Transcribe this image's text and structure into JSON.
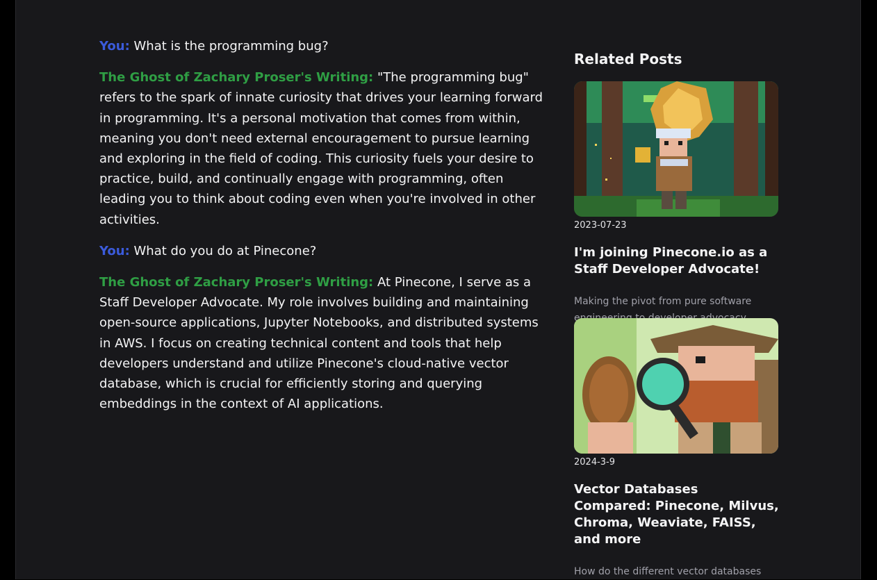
{
  "chat": {
    "messages": [
      {
        "speaker": "You:",
        "text": "What is the programming bug?"
      },
      {
        "speaker": "The Ghost of Zachary Proser's Writing:",
        "text": "\"The programming bug\" refers to the spark of innate curiosity that drives your learning forward in programming. It's a personal motivation that comes from within, meaning you don't need external encouragement to pursue learning and exploring in the field of coding. This curiosity fuels your desire to practice, build, and continually engage with programming, often leading you to think about coding even when you're involved in other activities."
      },
      {
        "speaker": "You:",
        "text": "What do you do at Pinecone?"
      },
      {
        "speaker": "The Ghost of Zachary Proser's Writing:",
        "text": "At Pinecone, I serve as a Staff Developer Advocate. My role involves building and maintaining open-source applications, Jupyter Notebooks, and distributed systems in AWS. I focus on creating technical content and tools that help developers understand and utilize Pinecone's cloud-native vector database, which is crucial for efficiently storing and querying embeddings in the context of AI applications."
      }
    ]
  },
  "sidebar": {
    "title": "Related Posts",
    "posts": [
      {
        "image_icon": "pixel-art-explorer-forest-image",
        "date": "2023-07-23",
        "title": "I'm joining Pinecone.io as a Staff Developer Advocate!",
        "description": "Making the pivot from pure software engineering to developer advocacy"
      },
      {
        "image_icon": "pixel-art-explorer-pinecone-magnifier-image",
        "date": "2024-3-9",
        "title": "Vector Databases Compared: Pinecone, Milvus, Chroma, Weaviate, FAISS, and more",
        "description": "How do the different vector databases"
      }
    ]
  },
  "colors": {
    "background": "#18181b",
    "you_label": "#3b5bdb",
    "ghost_label": "#2f9e44",
    "text": "#f4f4f5",
    "muted": "#a1a1aa"
  }
}
